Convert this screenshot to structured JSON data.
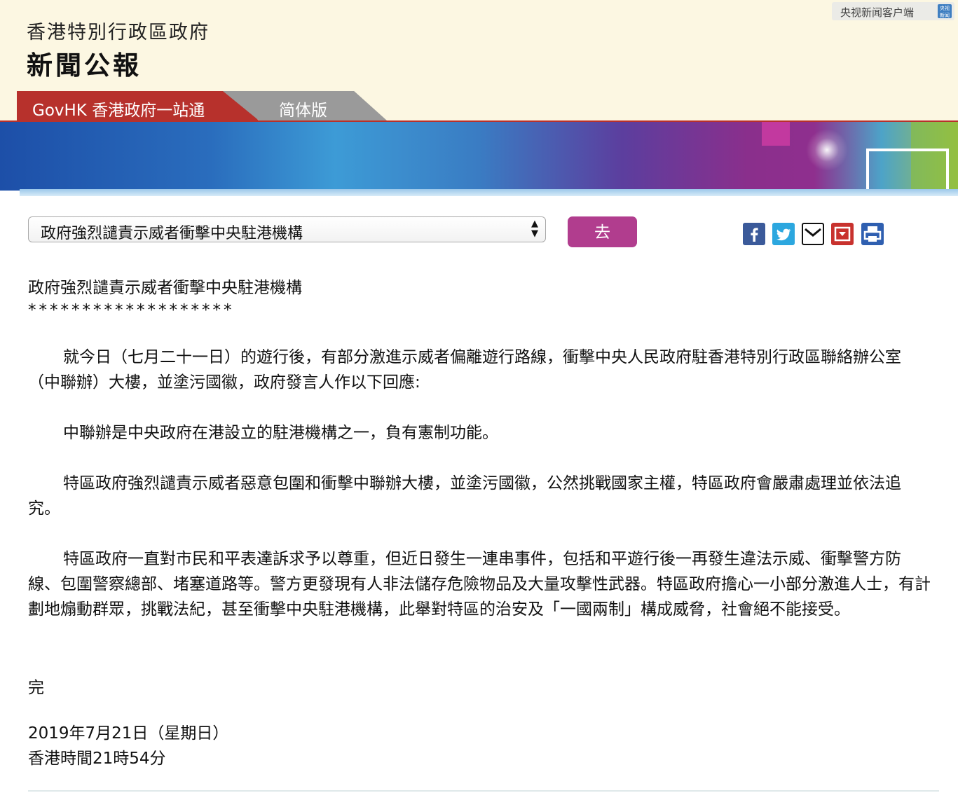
{
  "header": {
    "gov_name": "香港特別行政區政府",
    "press_title": "新聞公報",
    "watermark": "央视新闻客户端",
    "watermark_logo": "央视新闻"
  },
  "tabs": {
    "govhk": "GovHK 香港政府一站通",
    "simplified": "简体版"
  },
  "toolbar": {
    "selected_item": "政府強烈譴責示威者衝擊中央駐港機構",
    "go_label": "去",
    "share_icons": [
      "facebook-icon",
      "twitter-icon",
      "email-icon",
      "bookmark-icon",
      "print-icon"
    ]
  },
  "article": {
    "title": "政府強烈譴責示威者衝擊中央駐港機構",
    "stars": "*******************",
    "paragraphs": [
      "就今日（七月二十一日）的遊行後，有部分激進示威者偏離遊行路線，衝擊中央人民政府駐香港特別行政區聯絡辦公室（中聯辦）大樓，並塗污國徽，政府發言人作以下回應:",
      "中聯辦是中央政府在港設立的駐港機構之一，負有憲制功能。",
      "特區政府強烈譴責示威者惡意包圍和衝擊中聯辦大樓，並塗污國徽，公然挑戰國家主權，特區政府會嚴肅處理並依法追究。",
      "特區政府一直對市民和平表達訴求予以尊重，但近日發生一連串事件，包括和平遊行後一再發生違法示威、衝擊警方防線、包圍警察總部、堵塞道路等。警方更發現有人非法儲存危險物品及大量攻擊性武器。特區政府擔心一小部分激進人士，有計劃地煽動群眾，挑戰法紀，甚至衝擊中央駐港機構，此舉對特區的治安及「一國兩制」構成威脅，社會絕不能接受。"
    ],
    "end_mark": "完",
    "date": "2019年7月21日（星期日）",
    "time": "香港時間21時54分"
  },
  "colors": {
    "header_bg": "#fcf7e2",
    "tab_red": "#b7312c",
    "tab_grey": "#9a9a9a",
    "go_button": "#b13d8e"
  }
}
